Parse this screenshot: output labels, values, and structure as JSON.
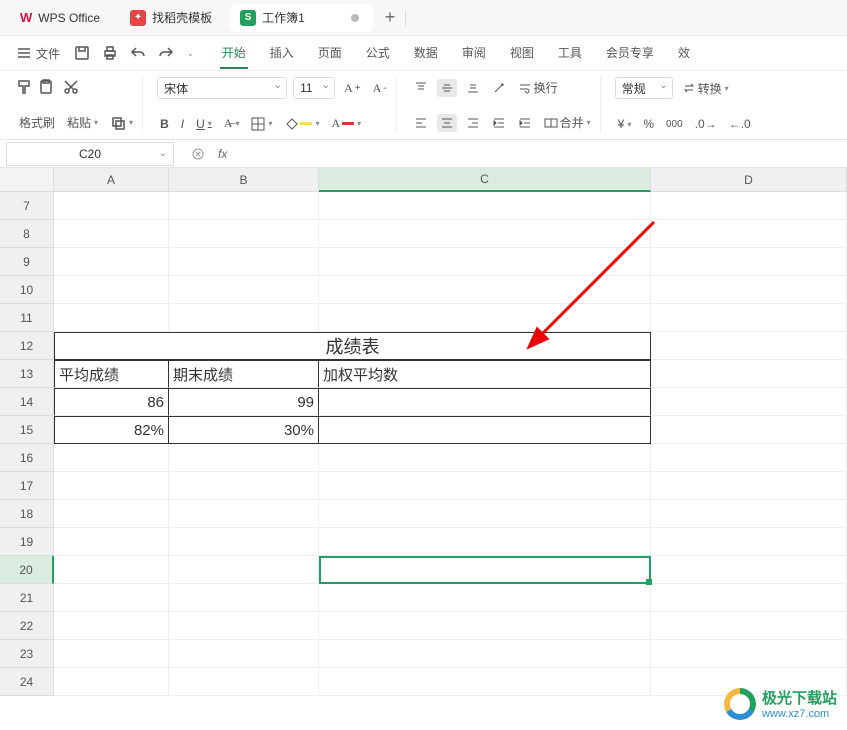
{
  "titlebar": {
    "app_name": "WPS Office",
    "template_tab": "找稻壳模板",
    "doc_tab": "工作簿1",
    "sheet_badge": "S"
  },
  "menubar": {
    "file": "文件",
    "items": [
      "开始",
      "插入",
      "页面",
      "公式",
      "数据",
      "审阅",
      "视图",
      "工具",
      "会员专享",
      "效"
    ],
    "active_index": 0
  },
  "ribbon": {
    "format_painter": "格式刷",
    "paste": "粘贴",
    "font_name": "宋体",
    "font_size": "11",
    "bold": "B",
    "italic": "I",
    "underline": "U",
    "wrap": "换行",
    "merge": "合并",
    "number_format": "常规",
    "convert": "转换",
    "currency": "¥"
  },
  "formula": {
    "cell_ref": "C20",
    "fx": "fx"
  },
  "grid": {
    "cols": [
      "A",
      "B",
      "C",
      "D"
    ],
    "row_start": 7,
    "row_end": 24,
    "selected_col": "C",
    "selected_row": 20,
    "title": "成绩表",
    "headers": {
      "A": "平均成绩",
      "B": "期末成绩",
      "C": "加权平均数"
    },
    "r14": {
      "A": "86",
      "B": "99"
    },
    "r15": {
      "A": "82%",
      "B": "30%"
    }
  },
  "watermark": {
    "cn": "极光下载站",
    "url": "www.xz7.com"
  }
}
